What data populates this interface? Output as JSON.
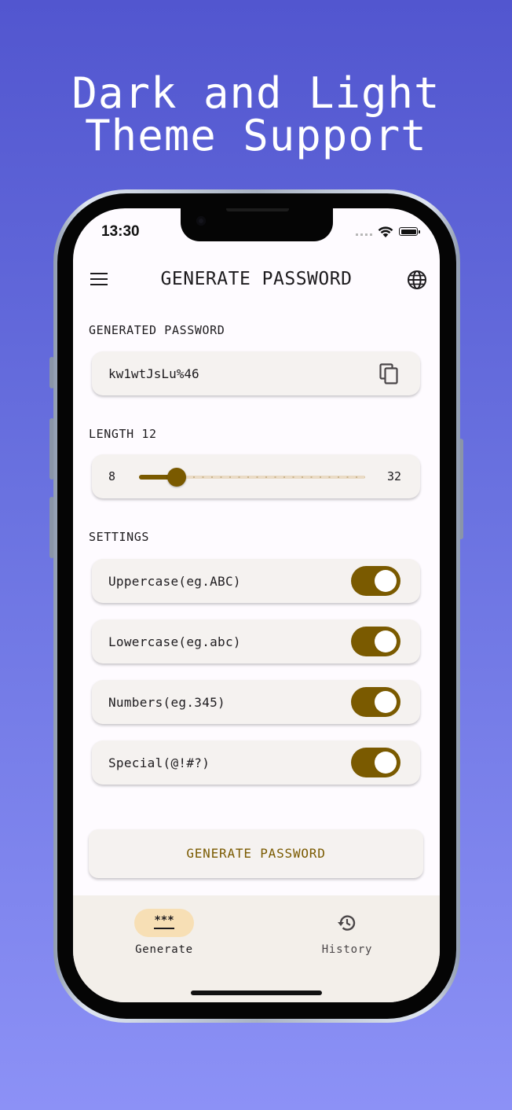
{
  "headline": {
    "line1": "Dark and Light",
    "line2": "Theme Support"
  },
  "status_bar": {
    "time": "13:30"
  },
  "top_bar": {
    "title": "GENERATE PASSWORD",
    "menu_icon": "menu-icon",
    "language_icon": "globe-icon"
  },
  "generated": {
    "section_label": "GENERATED PASSWORD",
    "password": "kw1wtJsLu%46",
    "copy_icon": "copy-icon"
  },
  "length": {
    "section_label": "LENGTH 12",
    "min_label": "8",
    "max_label": "32",
    "min": 8,
    "max": 32,
    "value": 12
  },
  "settings": {
    "section_label": "SETTINGS",
    "options": [
      {
        "label": "Uppercase(eg.ABC)",
        "enabled": true
      },
      {
        "label": "Lowercase(eg.abc)",
        "enabled": true
      },
      {
        "label": "Numbers(eg.345)",
        "enabled": true
      },
      {
        "label": "Special(@!#?)",
        "enabled": true
      }
    ]
  },
  "generate_button": {
    "label": "GENERATE PASSWORD"
  },
  "bottom_nav": {
    "items": [
      {
        "label": "Generate",
        "icon": "password-icon",
        "selected": true
      },
      {
        "label": "History",
        "icon": "history-icon",
        "selected": false
      }
    ]
  },
  "colors": {
    "accent": "#7a5a00",
    "background_gradient_top": "#5256cf",
    "background_gradient_bottom": "#8c91f6",
    "card": "#f5f2f0",
    "nav_selected": "#f7dfb5"
  }
}
